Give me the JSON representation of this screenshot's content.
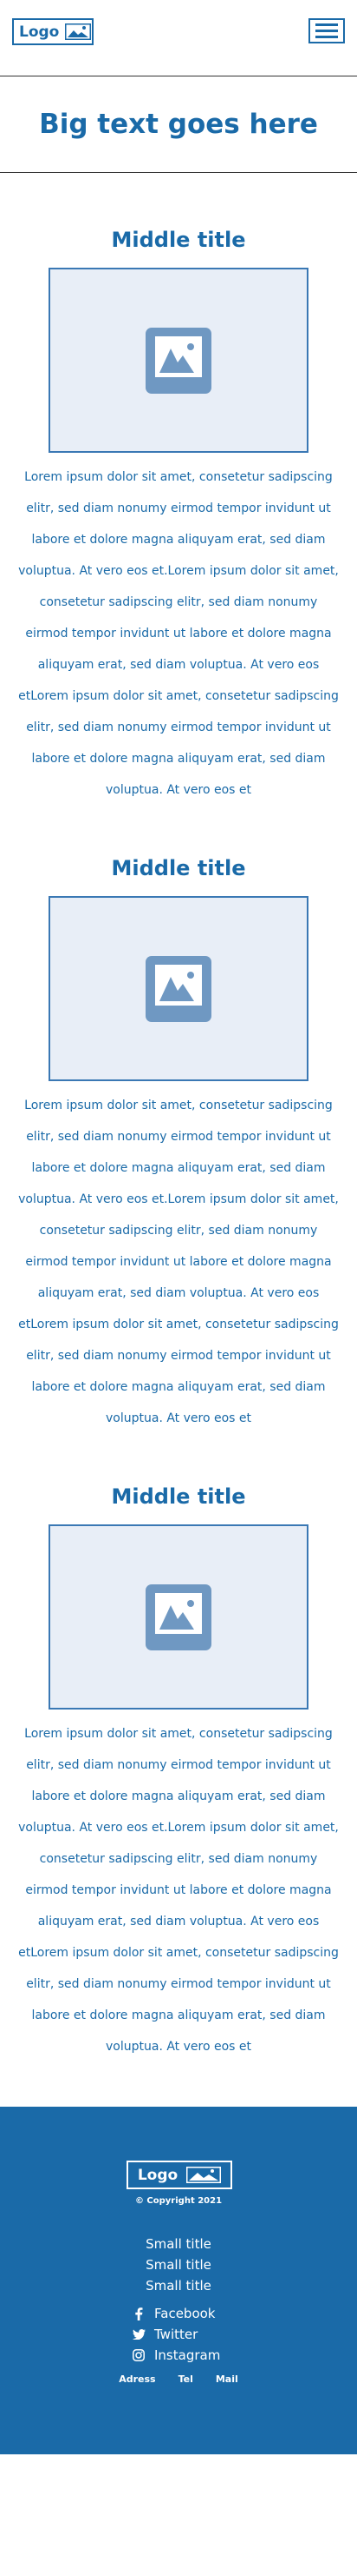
{
  "header": {
    "logo_text": "Logo",
    "menu_icon": "hamburger-menu-icon"
  },
  "hero": {
    "title": "Big text goes here"
  },
  "sections": [
    {
      "title": "Middle title",
      "image_icon": "image-placeholder-icon",
      "paragraph": "Lorem ipsum dolor sit amet, consetetur sadipscing elitr, sed diam nonumy eirmod tempor invidunt ut labore et dolore magna aliquyam erat, sed diam voluptua. At vero eos et.Lorem ipsum dolor sit amet, consetetur sadipscing elitr, sed diam nonumy eirmod tempor invidunt ut labore et dolore magna aliquyam erat, sed diam voluptua. At vero eos etLorem ipsum dolor sit amet, consetetur sadipscing elitr, sed diam nonumy eirmod tempor invidunt ut labore et dolore magna aliquyam erat, sed diam voluptua. At vero eos et"
    },
    {
      "title": "Middle title",
      "image_icon": "image-placeholder-icon",
      "paragraph": "Lorem ipsum dolor sit amet, consetetur sadipscing elitr, sed diam nonumy eirmod tempor invidunt ut labore et dolore magna aliquyam erat, sed diam voluptua. At vero eos et.Lorem ipsum dolor sit amet, consetetur sadipscing elitr, sed diam nonumy eirmod tempor invidunt ut labore et dolore magna aliquyam erat, sed diam voluptua. At vero eos etLorem ipsum dolor sit amet, consetetur sadipscing elitr, sed diam nonumy eirmod tempor invidunt ut labore et dolore magna aliquyam erat, sed diam voluptua. At vero eos et"
    },
    {
      "title": "Middle title",
      "image_icon": "image-placeholder-icon",
      "paragraph": "Lorem ipsum dolor sit amet, consetetur sadipscing elitr, sed diam nonumy eirmod tempor invidunt ut labore et dolore magna aliquyam erat, sed diam voluptua. At vero eos et.Lorem ipsum dolor sit amet, consetetur sadipscing elitr, sed diam nonumy eirmod tempor invidunt ut labore et dolore magna aliquyam erat, sed diam voluptua. At vero eos etLorem ipsum dolor sit amet, consetetur sadipscing elitr, sed diam nonumy eirmod tempor invidunt ut labore et dolore magna aliquyam erat, sed diam voluptua. At vero eos et"
    }
  ],
  "footer": {
    "logo_text": "Logo",
    "copyright": "© Copyright 2021",
    "small_titles": [
      "Small title",
      "Small title",
      "Small title"
    ],
    "social": [
      {
        "label": "Facebook",
        "icon": "facebook-icon"
      },
      {
        "label": "Twitter",
        "icon": "twitter-icon"
      },
      {
        "label": "Instagram",
        "icon": "instagram-icon"
      }
    ],
    "links": [
      "Adress",
      "Tel",
      "Mail"
    ]
  },
  "colors": {
    "brand_blue": "#1a6aa8",
    "image_bg": "#e8eef7",
    "footer_bg": "#1a6aa8"
  }
}
